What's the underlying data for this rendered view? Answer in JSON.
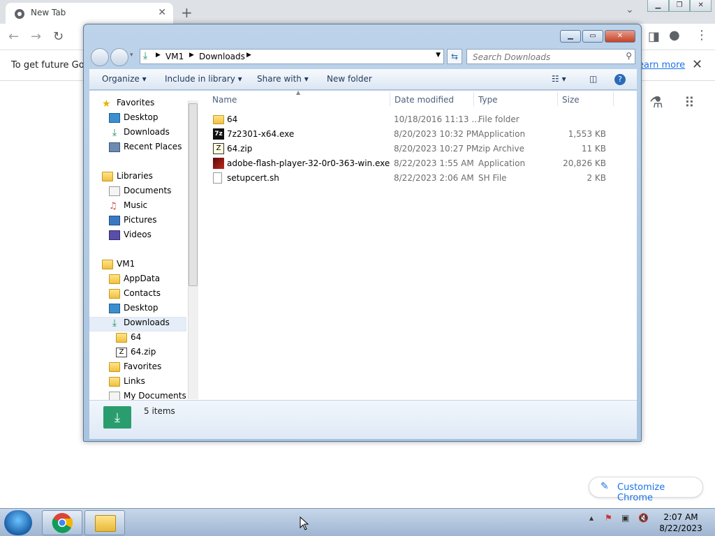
{
  "chrome": {
    "tab_title": "New Tab",
    "infobar_text": "To get future Goo",
    "learn_more": "earn more",
    "customize_label": "Customize Chrome"
  },
  "explorer": {
    "breadcrumb": [
      "VM1",
      "Downloads"
    ],
    "search_placeholder": "Search Downloads",
    "commands": {
      "organize": "Organize",
      "include_in_library": "Include in library",
      "share_with": "Share with",
      "new_folder": "New folder"
    },
    "nav": {
      "favorites": "Favorites",
      "desktop": "Desktop",
      "downloads": "Downloads",
      "recent_places": "Recent Places",
      "libraries": "Libraries",
      "documents": "Documents",
      "music": "Music",
      "pictures": "Pictures",
      "videos": "Videos",
      "vm1": "VM1",
      "appdata": "AppData",
      "contacts": "Contacts",
      "desktop2": "Desktop",
      "downloads2": "Downloads",
      "sub64": "64",
      "sub64zip": "64.zip",
      "favorites2": "Favorites",
      "links": "Links",
      "my_documents": "My Documents"
    },
    "columns": {
      "name": "Name",
      "date_modified": "Date modified",
      "type": "Type",
      "size": "Size"
    },
    "files": [
      {
        "name": "64",
        "date": "10/18/2016 11:13 ...",
        "type": "File folder",
        "size": ""
      },
      {
        "name": "7z2301-x64.exe",
        "date": "8/20/2023 10:32 PM",
        "type": "Application",
        "size": "1,553 KB"
      },
      {
        "name": "64.zip",
        "date": "8/20/2023 10:27 PM",
        "type": "zip Archive",
        "size": "11 KB"
      },
      {
        "name": "adobe-flash-player-32-0r0-363-win.exe",
        "date": "8/22/2023 1:55 AM",
        "type": "Application",
        "size": "20,826 KB"
      },
      {
        "name": "setupcert.sh",
        "date": "8/22/2023 2:06 AM",
        "type": "SH File",
        "size": "2 KB"
      }
    ],
    "item_count": "5 items"
  },
  "taskbar": {
    "time": "2:07 AM",
    "date": "8/22/2023"
  }
}
